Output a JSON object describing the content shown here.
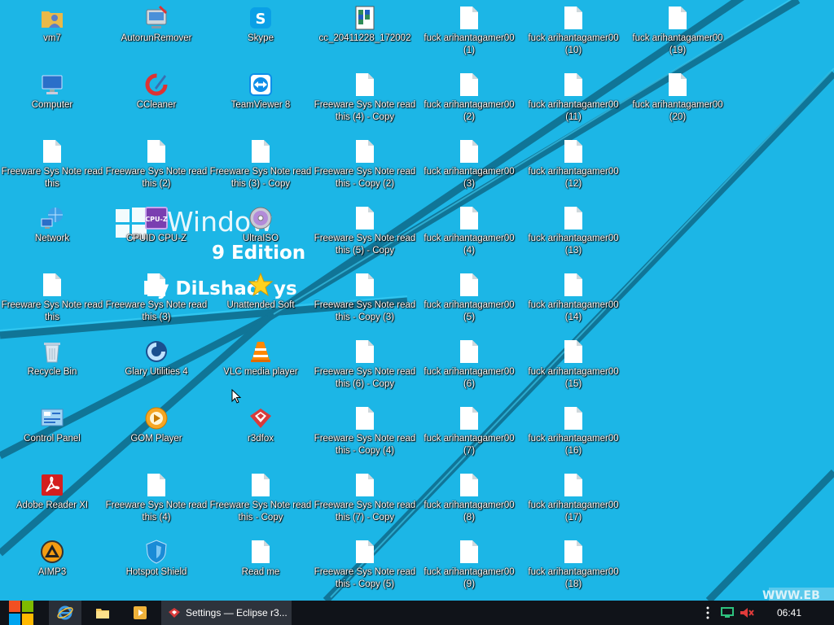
{
  "desktop": {
    "background_color": "#1cb6e6",
    "wallpaper_text": {
      "windows": "Window",
      "edition": "9 Edition",
      "author": "By DiLshad",
      "author_suffix": "ys",
      "url_fragment": "WWW.EB"
    },
    "icons": [
      {
        "label": "vm7",
        "icon": "user-folder-icon"
      },
      {
        "label": "AutorunRemover",
        "icon": "autorun-remover-icon"
      },
      {
        "label": "Skype",
        "icon": "skype-icon"
      },
      {
        "label": "cc_20411228_172002",
        "icon": "registry-file-icon"
      },
      {
        "label": "fuck arihantagamer00 (1)",
        "icon": "blank-file-icon"
      },
      {
        "label": "fuck arihantagamer00 (10)",
        "icon": "blank-file-icon"
      },
      {
        "label": "fuck arihantagamer00 (19)",
        "icon": "blank-file-icon"
      },
      {
        "label": "Computer",
        "icon": "computer-icon"
      },
      {
        "label": "CCleaner",
        "icon": "ccleaner-icon"
      },
      {
        "label": "TeamViewer 8",
        "icon": "teamviewer-icon"
      },
      {
        "label": "Freeware Sys Note read this (4) - Copy",
        "icon": "blank-file-icon"
      },
      {
        "label": "fuck arihantagamer00 (2)",
        "icon": "blank-file-icon"
      },
      {
        "label": "fuck arihantagamer00 (11)",
        "icon": "blank-file-icon"
      },
      {
        "label": "fuck arihantagamer00 (20)",
        "icon": "blank-file-icon"
      },
      {
        "label": "Freeware Sys Note read this",
        "icon": "blank-file-icon"
      },
      {
        "label": "Freeware Sys Note read this (2)",
        "icon": "blank-file-icon"
      },
      {
        "label": "Freeware Sys Note read this (3) - Copy",
        "icon": "blank-file-icon"
      },
      {
        "label": "Freeware Sys Note read this - Copy (2)",
        "icon": "blank-file-icon"
      },
      {
        "label": "fuck arihantagamer00 (3)",
        "icon": "blank-file-icon"
      },
      {
        "label": "fuck arihantagamer00 (12)",
        "icon": "blank-file-icon"
      },
      {
        "label": "Network",
        "icon": "network-icon"
      },
      {
        "label": "CPUID CPU-Z",
        "icon": "cpuz-icon"
      },
      {
        "label": "UltraISO",
        "icon": "ultraiso-icon"
      },
      {
        "label": "Freeware Sys Note read this (5) - Copy",
        "icon": "blank-file-icon"
      },
      {
        "label": "fuck arihantagamer00 (4)",
        "icon": "blank-file-icon"
      },
      {
        "label": "fuck arihantagamer00 (13)",
        "icon": "blank-file-icon"
      },
      {
        "label": "Freeware Sys Note read this",
        "icon": "blank-file-icon"
      },
      {
        "label": "Freeware Sys Note read this (3)",
        "icon": "blank-file-icon"
      },
      {
        "label": "Unattended Soft",
        "icon": "star-icon"
      },
      {
        "label": "Freeware Sys Note read this - Copy (3)",
        "icon": "blank-file-icon"
      },
      {
        "label": "fuck arihantagamer00 (5)",
        "icon": "blank-file-icon"
      },
      {
        "label": "fuck arihantagamer00 (14)",
        "icon": "blank-file-icon"
      },
      {
        "label": "Recycle Bin",
        "icon": "recycle-bin-icon"
      },
      {
        "label": "Glary Utilities 4",
        "icon": "glary-utilities-icon"
      },
      {
        "label": "VLC media player",
        "icon": "vlc-icon"
      },
      {
        "label": "Freeware Sys Note read this (6) - Copy",
        "icon": "blank-file-icon"
      },
      {
        "label": "fuck arihantagamer00 (6)",
        "icon": "blank-file-icon"
      },
      {
        "label": "fuck arihantagamer00 (15)",
        "icon": "blank-file-icon"
      },
      {
        "label": "Control Panel",
        "icon": "control-panel-icon"
      },
      {
        "label": "GOM Player",
        "icon": "gom-player-icon"
      },
      {
        "label": "r3dfox",
        "icon": "r3dfox-icon"
      },
      {
        "label": "Freeware Sys Note read this - Copy (4)",
        "icon": "blank-file-icon"
      },
      {
        "label": "fuck arihantagamer00 (7)",
        "icon": "blank-file-icon"
      },
      {
        "label": "fuck arihantagamer00 (16)",
        "icon": "blank-file-icon"
      },
      {
        "label": "Adobe Reader XI",
        "icon": "adobe-reader-icon"
      },
      {
        "label": "Freeware Sys Note read this (4)",
        "icon": "blank-file-icon"
      },
      {
        "label": "Freeware Sys Note read this - Copy",
        "icon": "blank-file-icon"
      },
      {
        "label": "Freeware Sys Note read this (7) - Copy",
        "icon": "blank-file-icon"
      },
      {
        "label": "fuck arihantagamer00 (8)",
        "icon": "blank-file-icon"
      },
      {
        "label": "fuck arihantagamer00 (17)",
        "icon": "blank-file-icon"
      },
      {
        "label": "AIMP3",
        "icon": "aimp-icon"
      },
      {
        "label": "Hotspot Shield",
        "icon": "hotspot-shield-icon"
      },
      {
        "label": "Read me",
        "icon": "blank-file-icon"
      },
      {
        "label": "Freeware Sys Note read this - Copy (5)",
        "icon": "blank-file-icon"
      },
      {
        "label": "fuck arihantagamer00 (9)",
        "icon": "blank-file-icon"
      },
      {
        "label": "fuck arihantagamer00 (18)",
        "icon": "blank-file-icon"
      }
    ]
  },
  "taskbar": {
    "start": {
      "icon": "windows-logo-icon"
    },
    "pinned": [
      {
        "name": "internet-explorer",
        "icon": "internet-explorer-icon"
      },
      {
        "name": "file-explorer",
        "icon": "folder-icon"
      },
      {
        "name": "media-player",
        "icon": "media-player-icon"
      }
    ],
    "active_task": {
      "label": "Settings — Eclipse r3...",
      "icon": "r3dfox-icon"
    },
    "tray": {
      "icons": [
        "overflow-dots-icon",
        "network-monitor-icon",
        "volume-muted-icon"
      ]
    },
    "clock": "06:41"
  }
}
